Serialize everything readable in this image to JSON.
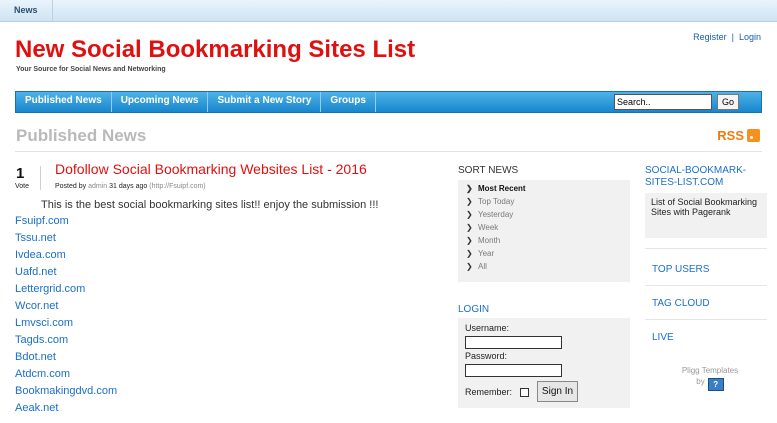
{
  "topbar": {
    "news_label": "News"
  },
  "header": {
    "title": "New Social Bookmarking Sites List",
    "tagline": "Your Source for Social News and Networking",
    "register": "Register",
    "separator": "|",
    "login": "Login"
  },
  "nav": {
    "items": [
      "Published News",
      "Upcoming News",
      "Submit a New Story",
      "Groups"
    ],
    "search_value": "Search..",
    "go_label": "Go"
  },
  "page": {
    "heading": "Published News",
    "rss_label": "RSS"
  },
  "story": {
    "votes": "1",
    "vote_label": "Vote",
    "title": "Dofollow Social Bookmarking Websites List - 2016",
    "posted_by": "Posted by",
    "author": "admin",
    "age": "31 days ago",
    "source": "(http://Fsuipf.com)",
    "body": "This is the best social bookmarking sites list!! enjoy the submission !!!",
    "links": [
      "Fsuipf.com",
      "Tssu.net",
      "Ivdea.com",
      "Uafd.net",
      "Lettergrid.com",
      "Wcor.net",
      "Lmvsci.com",
      "Tagds.com",
      "Bdot.net",
      "Atdcm.com",
      "Bookmakingdvd.com",
      "Aeak.net"
    ]
  },
  "sort_news": {
    "title": "SORT NEWS",
    "options": [
      "Most Recent",
      "Top Today",
      "Yesterday",
      "Week",
      "Month",
      "Year",
      "All"
    ],
    "active": "Most Recent"
  },
  "login_box": {
    "title": "LOGIN",
    "username_label": "Username:",
    "password_label": "Password:",
    "remember_label": "Remember:",
    "signin_label": "Sign In"
  },
  "right_sidebar": {
    "site_title": "SOCIAL-BOOKMARK-SITES-LIST.COM",
    "site_description": "List of Social Bookmarking Sites with Pagerank",
    "links": [
      "TOP USERS",
      "TAG CLOUD",
      "LIVE"
    ],
    "footer_text": "Pligg Templates",
    "footer_by": "by"
  },
  "colors": {
    "accent_red": "#e01010",
    "link_blue": "#1a6fc9",
    "nav_blue": "#1786cc",
    "rss_orange": "#f07a10"
  }
}
